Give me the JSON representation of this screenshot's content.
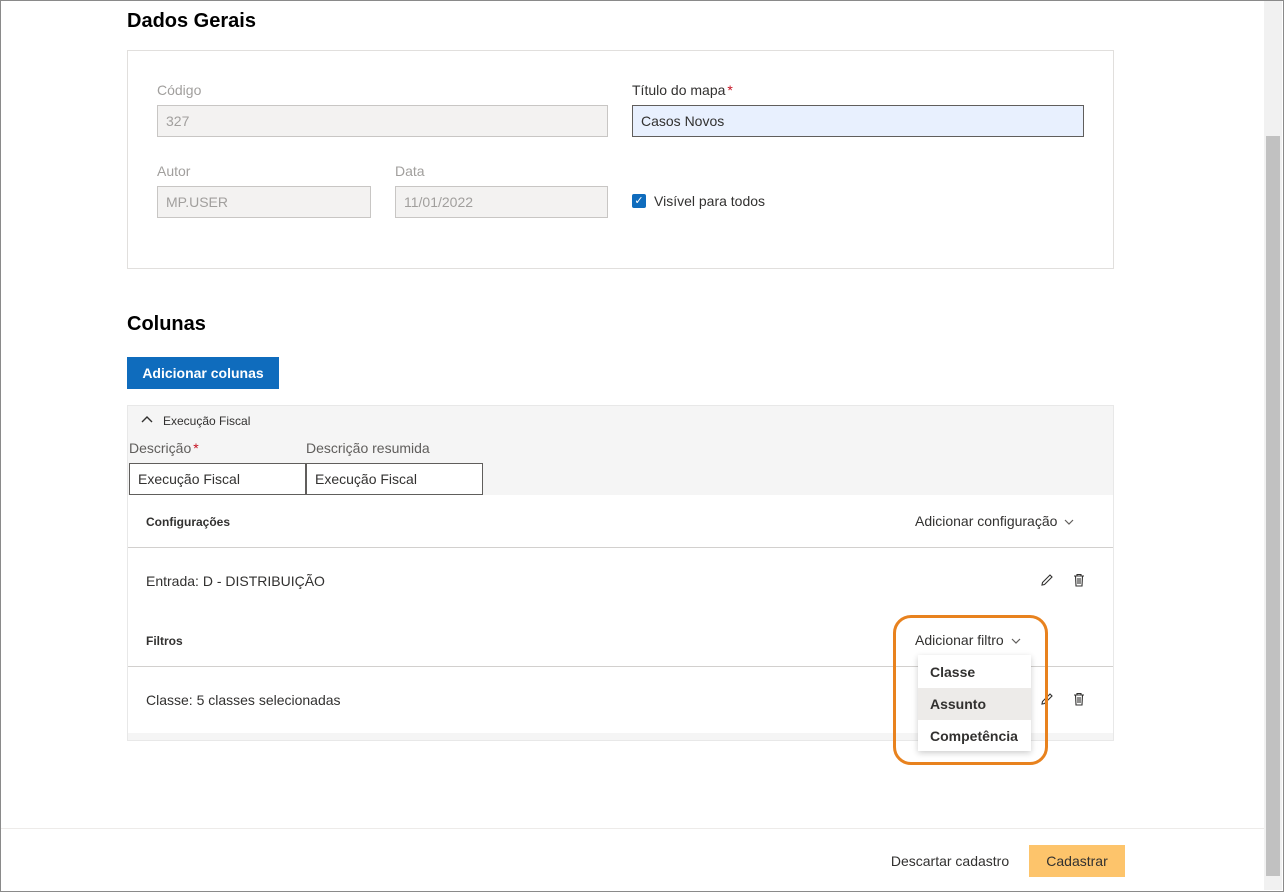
{
  "dados_gerais": {
    "title": "Dados Gerais",
    "codigo_label": "Código",
    "codigo_value": "327",
    "titulo_label": "Título do mapa",
    "titulo_value": "Casos Novos",
    "autor_label": "Autor",
    "autor_value": "MP.USER",
    "data_label": "Data",
    "data_value": "11/01/2022",
    "visivel_label": "Visível para todos",
    "visivel_checked": true,
    "required_mark": "*"
  },
  "colunas": {
    "title": "Colunas",
    "add_button": "Adicionar colunas",
    "section_title": "Execução Fiscal",
    "descricao_label": "Descrição",
    "descricao_value": "Execução Fiscal",
    "descricao_resumida_label": "Descrição resumida",
    "descricao_resumida_value": "Execução Fiscal",
    "configuracoes_label": "Configurações",
    "add_config": "Adicionar configuração",
    "config_item": "Entrada: D - DISTRIBUIÇÃO",
    "filtros_label": "Filtros",
    "add_filtro": "Adicionar filtro",
    "filtro_item": "Classe: 5 classes selecionadas"
  },
  "dropdown": {
    "items": [
      "Classe",
      "Assunto",
      "Competência"
    ],
    "hovered_index": 1
  },
  "footer": {
    "discard": "Descartar cadastro",
    "submit": "Cadastrar"
  },
  "colors": {
    "primary": "#0f6cbd",
    "highlight": "#e8821e",
    "submit": "#fdc46b"
  }
}
